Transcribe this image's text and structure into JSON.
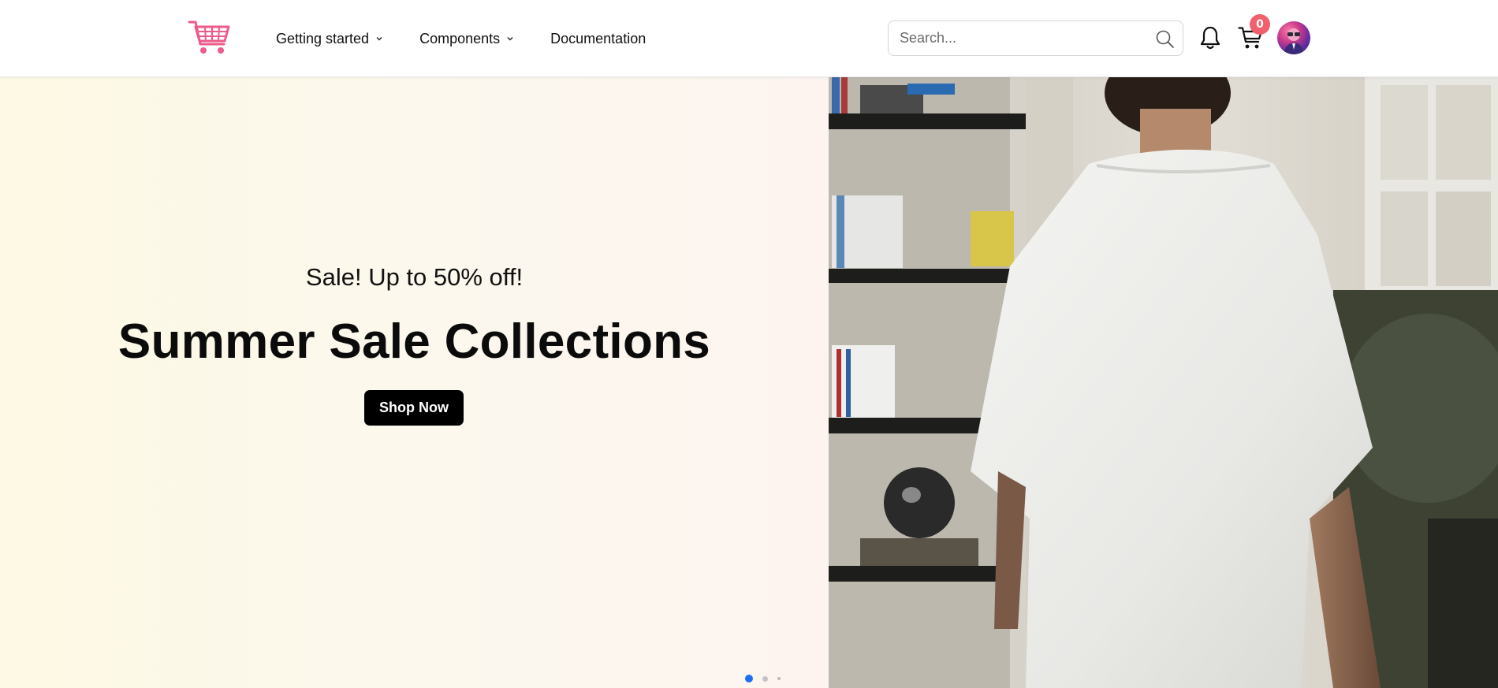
{
  "header": {
    "logo_icon": "shopping-cart-logo-icon",
    "nav": [
      {
        "label": "Getting started",
        "has_dropdown": true
      },
      {
        "label": "Components",
        "has_dropdown": true
      },
      {
        "label": "Documentation",
        "has_dropdown": false
      }
    ],
    "search": {
      "placeholder": "Search...",
      "value": ""
    },
    "cart_count": "0",
    "brand_color": "#f0616d"
  },
  "hero": {
    "subtitle": "Sale! Up to 50% off!",
    "title": "Summer Sale Collections",
    "cta_label": "Shop Now",
    "slides_total": 3,
    "active_slide": 1,
    "active_dot_color": "#1e6ff0"
  }
}
